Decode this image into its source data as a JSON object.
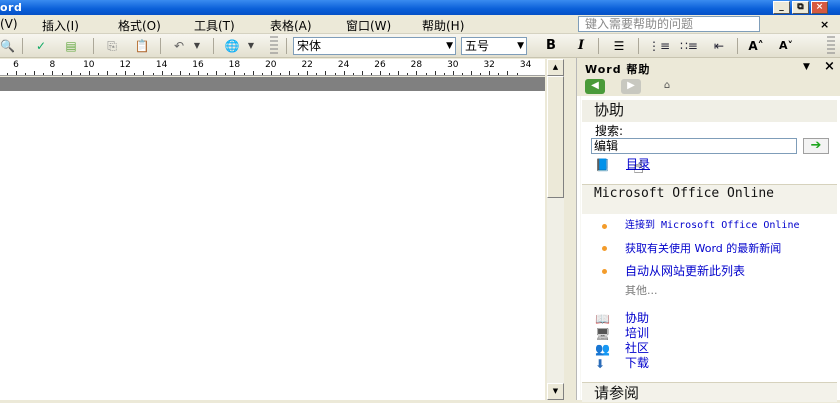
{
  "title": "ord",
  "window_buttons": [
    "_",
    "⧉",
    "×"
  ],
  "menu": {
    "items": [
      "(V)",
      "插入(I)",
      "格式(O)",
      "工具(T)",
      "表格(A)",
      "窗口(W)",
      "帮助(H)"
    ],
    "help_placeholder": "键入需要帮助的问题",
    "doc_close": "×"
  },
  "toolbar": {
    "font_name": "宋体",
    "font_size": "五号",
    "bold_label": "B",
    "italic_label": "I",
    "grow_font": "A˄",
    "shrink_font": "A˅"
  },
  "ruler": {
    "numbers": [
      "6",
      "8",
      "10",
      "12",
      "14",
      "16",
      "18",
      "20",
      "22",
      "24",
      "26",
      "28",
      "30",
      "32",
      "34"
    ]
  },
  "pane": {
    "title": "Word 帮助",
    "menu_arrow": "▼",
    "close": "×",
    "assist_heading": "协助",
    "search_label": "搜索:",
    "search_value": "编辑",
    "toc_link": "目录",
    "online_heading": "Microsoft Office Online",
    "online_links": [
      "连接到 Microsoft Office Online",
      "获取有关使用 Word 的最新新闻",
      "自动从网站更新此列表"
    ],
    "more": "其他...",
    "resource_links": [
      "协助",
      "培训",
      "社区",
      "下载"
    ],
    "see_also_heading": "请参阅"
  },
  "colors": {
    "title_blue": "#0a5fd8",
    "link": "#0000cc",
    "bullet": "#f39c2b",
    "go_green": "#1ea51e"
  }
}
